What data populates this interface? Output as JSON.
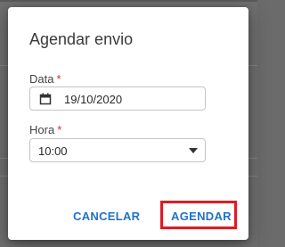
{
  "dialog": {
    "title": "Agendar envio",
    "date_field": {
      "label": "Data",
      "required_mark": "*",
      "value": "19/10/2020",
      "icon": "calendar-icon"
    },
    "time_field": {
      "label": "Hora",
      "required_mark": "*",
      "value": "10:00",
      "icon": "caret-down-icon"
    },
    "actions": {
      "cancel_label": "CANCELAR",
      "schedule_label": "AGENDAR"
    }
  },
  "colors": {
    "accent": "#1e73c9",
    "required": "#d32f2f",
    "highlight": "#e01b24",
    "overlay": "#6f6f6f"
  }
}
